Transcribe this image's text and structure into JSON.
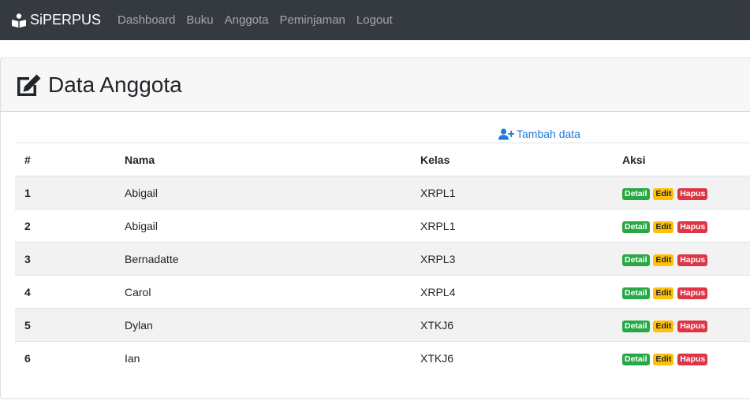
{
  "navbar": {
    "brand": "SiPERPUS",
    "links": [
      "Dashboard",
      "Buku",
      "Anggota",
      "Peminjaman",
      "Logout"
    ]
  },
  "page": {
    "title": "Data Anggota",
    "add_label": "Tambah data"
  },
  "table": {
    "headers": [
      "#",
      "Nama",
      "Kelas",
      "Aksi"
    ],
    "rows": [
      {
        "no": "1",
        "nama": "Abigail",
        "kelas": "XRPL1"
      },
      {
        "no": "2",
        "nama": "Abigail",
        "kelas": "XRPL1"
      },
      {
        "no": "3",
        "nama": "Bernadatte",
        "kelas": "XRPL3"
      },
      {
        "no": "4",
        "nama": "Carol",
        "kelas": "XRPL4"
      },
      {
        "no": "5",
        "nama": "Dylan",
        "kelas": "XTKJ6"
      },
      {
        "no": "6",
        "nama": "Ian",
        "kelas": "XTKJ6"
      }
    ],
    "actions": {
      "detail": "Detail",
      "edit": "Edit",
      "hapus": "Hapus"
    }
  },
  "colors": {
    "navbar": "#343a40",
    "link": "#1f7ae0",
    "success": "#28a745",
    "warning": "#ffc107",
    "danger": "#dc3545"
  },
  "icons": {
    "brand": "book-reader-icon",
    "title": "edit-icon",
    "add": "user-plus-icon"
  }
}
